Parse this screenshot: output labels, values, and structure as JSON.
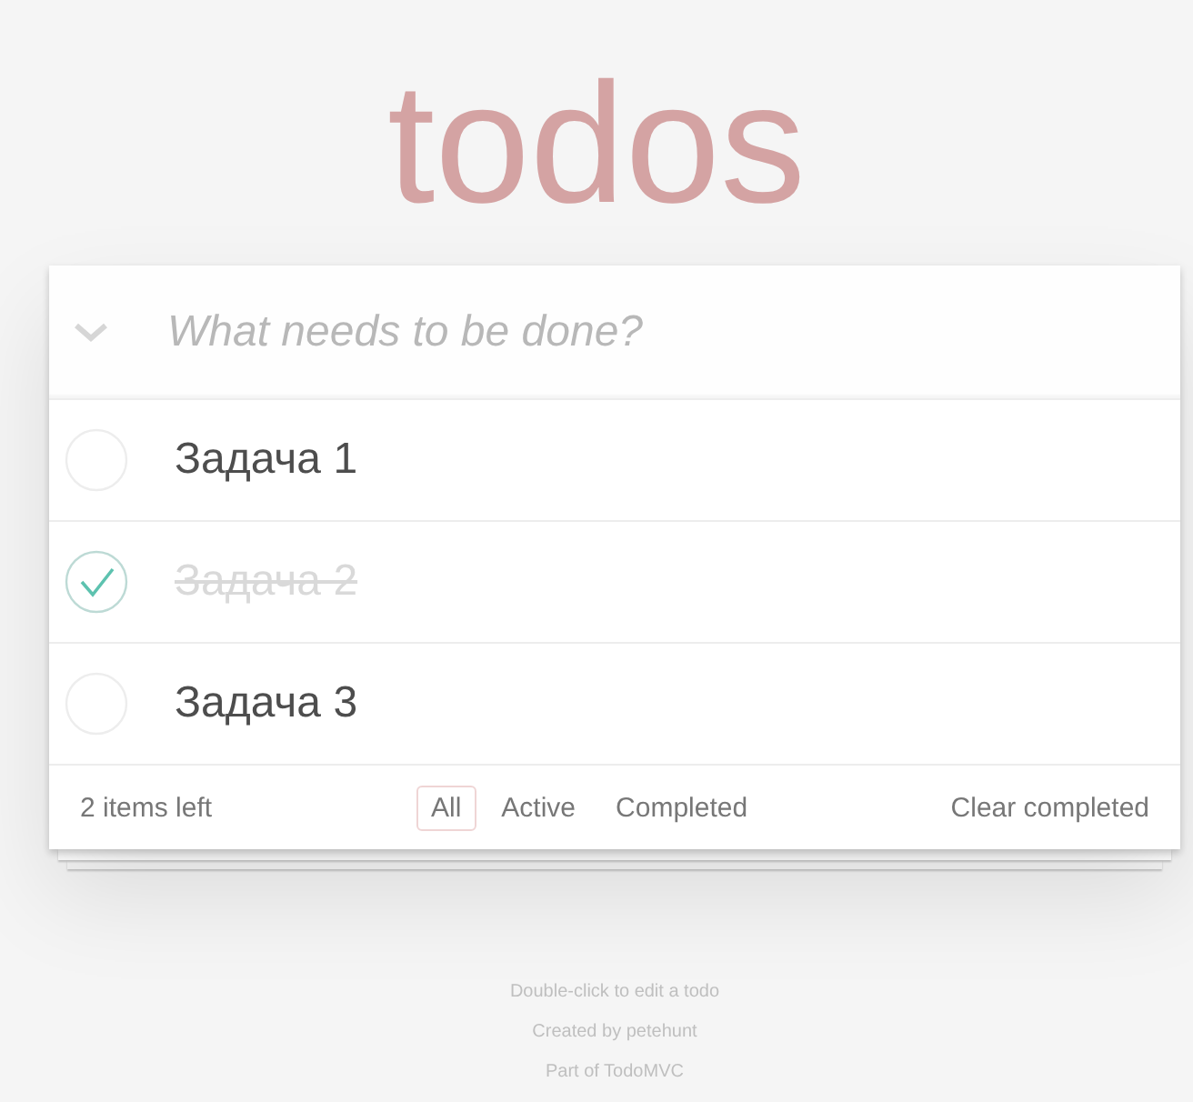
{
  "title": "todos",
  "new_todo": {
    "placeholder": "What needs to be done?"
  },
  "todos": [
    {
      "text": "Задача 1",
      "completed": false
    },
    {
      "text": "Задача 2",
      "completed": true
    },
    {
      "text": "Задача 3",
      "completed": false
    }
  ],
  "footer": {
    "count": "2 items left",
    "filters": [
      {
        "label": "All",
        "selected": true
      },
      {
        "label": "Active",
        "selected": false
      },
      {
        "label": "Completed",
        "selected": false
      }
    ],
    "clear": "Clear completed"
  },
  "info": [
    "Double-click to edit a todo",
    "Created by petehunt",
    "Part of TodoMVC"
  ]
}
